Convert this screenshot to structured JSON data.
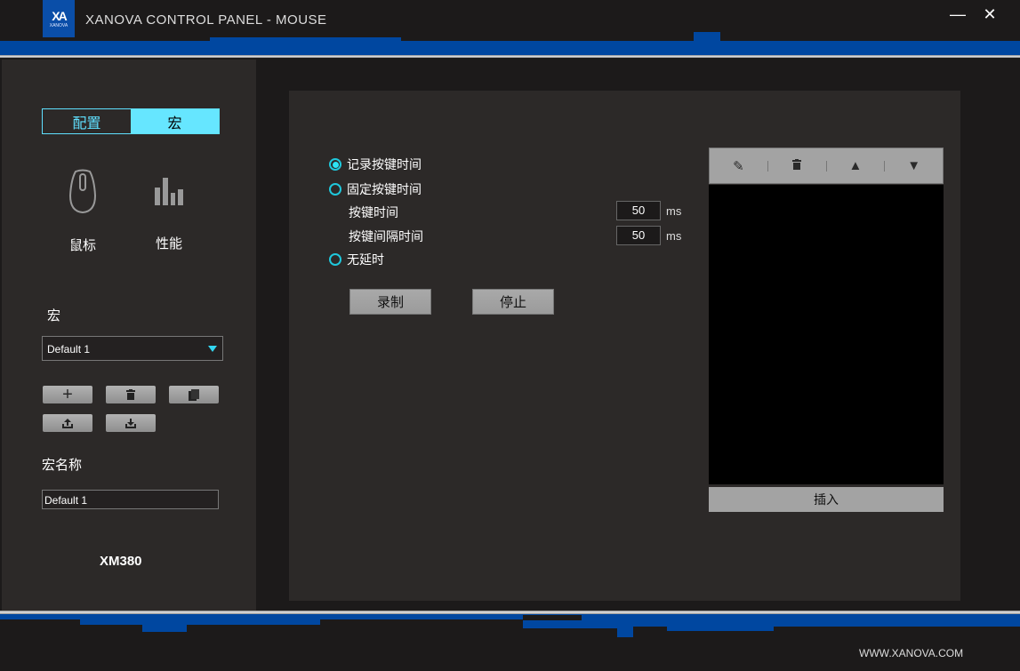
{
  "window": {
    "title": "XANOVA CONTROL PANEL - MOUSE",
    "logo_text": "XANOVA",
    "minimize": "—",
    "close": "✕"
  },
  "sidebar": {
    "tabs": [
      {
        "label": "配置"
      },
      {
        "label": "宏"
      }
    ],
    "nav": [
      {
        "label": "鼠标",
        "icon": "mouse-icon"
      },
      {
        "label": "性能",
        "icon": "bar-chart-icon"
      }
    ],
    "macro_label": "宏",
    "macro_select": "Default 1",
    "macro_name_label": "宏名称",
    "macro_name_value": "Default 1",
    "model": "XM380"
  },
  "main": {
    "options": [
      {
        "label": "记录按键时间",
        "selected": true
      },
      {
        "label": "固定按键时间",
        "selected": false
      },
      {
        "label": "无延时",
        "selected": false
      }
    ],
    "key_time_label": "按键时间",
    "key_time_value": "50",
    "key_time_unit": "ms",
    "interval_label": "按键间隔时间",
    "interval_value": "50",
    "interval_unit": "ms",
    "record_button": "录制",
    "stop_button": "停止",
    "insert_button": "插入"
  },
  "footer": {
    "website": "WWW.XANOVA.COM"
  },
  "colors": {
    "accent": "#66e6ff",
    "brand_blue": "#0047a0"
  }
}
